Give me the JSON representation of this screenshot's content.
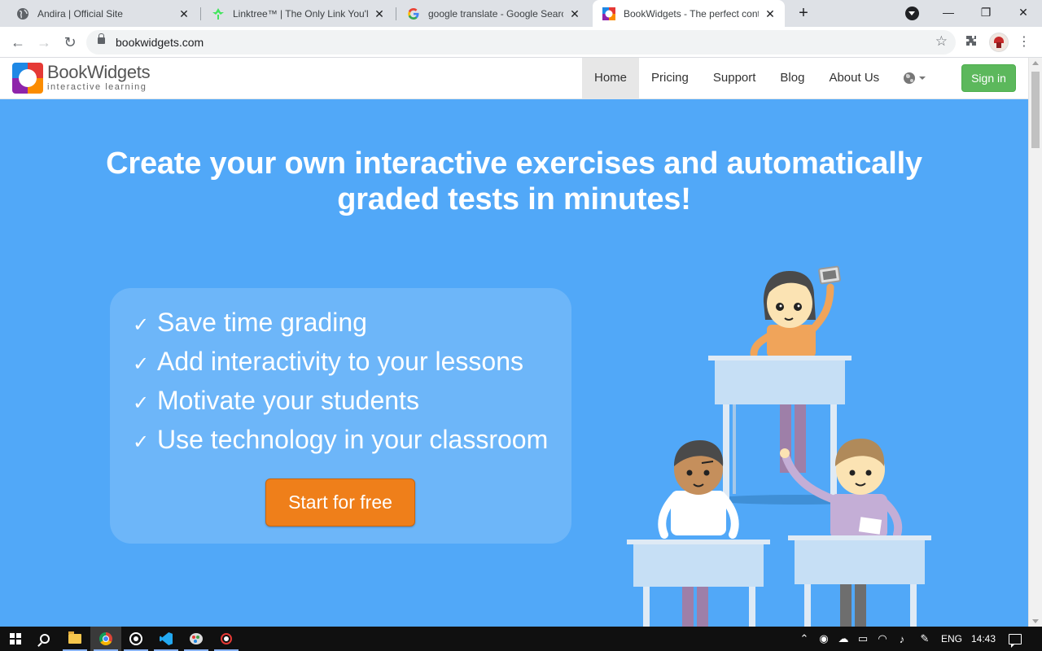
{
  "browser": {
    "tabs": [
      {
        "title": "Andira | Official Site",
        "icon": "globe-icon",
        "active": false
      },
      {
        "title": "Linktree™ | The Only Link You'll E",
        "icon": "linktree-icon",
        "active": false
      },
      {
        "title": "google translate - Google Search",
        "icon": "google-icon",
        "active": false
      },
      {
        "title": "BookWidgets - The perfect conte",
        "icon": "bookwidgets-icon",
        "active": true
      }
    ],
    "new_tab_label": "+",
    "url": "bookwidgets.com"
  },
  "site": {
    "logo_name": "BookWidgets",
    "logo_tagline": "interactive learning",
    "nav": [
      "Home",
      "Pricing",
      "Support",
      "Blog",
      "About Us"
    ],
    "active_nav": "Home",
    "signin_label": "Sign in",
    "hero_title": "Create your own interactive exercises and automatically graded tests in minutes!",
    "benefits": [
      "Save time grading",
      "Add interactivity to your lessons",
      "Motivate your students",
      "Use technology in your classroom"
    ],
    "check_mark": "✓",
    "cta_label": "Start for free"
  },
  "taskbar": {
    "apps": [
      "windows-start-icon",
      "search-icon",
      "file-explorer-icon",
      "chrome-icon",
      "obs-icon",
      "vscode-icon",
      "paint-icon",
      "recorder-icon"
    ],
    "language": "ENG",
    "time": "14:43"
  },
  "colors": {
    "hero_background": "#51a8f8",
    "signin_green": "#5cb85c",
    "cta_orange": "#ef7f1a"
  }
}
